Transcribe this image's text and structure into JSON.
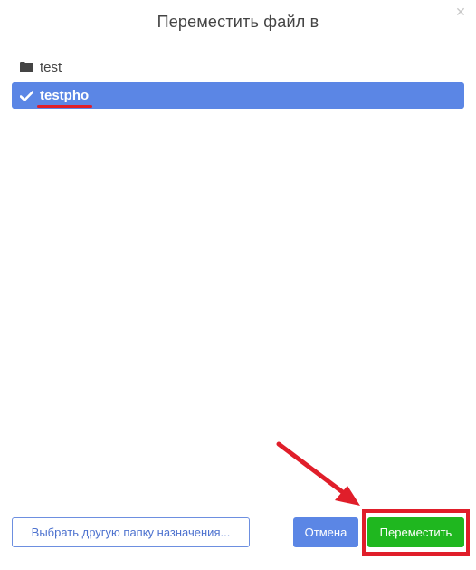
{
  "dialog": {
    "title": "Переместить файл в",
    "close_icon": "close-icon"
  },
  "folders": [
    {
      "label": "test",
      "icon": "folder-icon",
      "selected": false
    },
    {
      "label": "testpho",
      "icon": "checkmark-icon",
      "selected": true
    }
  ],
  "footer": {
    "choose_label": "Выбрать другую папку назначения...",
    "cancel_label": "Отмена",
    "move_label": "Переместить"
  },
  "colors": {
    "selected_bg": "#5b86e5",
    "move_button": "#1fb71f",
    "annotation": "#e01e2a"
  }
}
